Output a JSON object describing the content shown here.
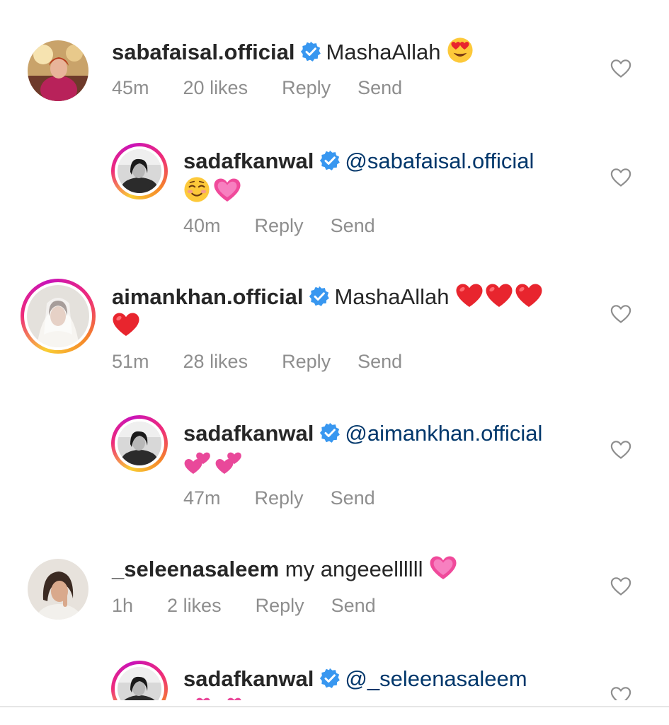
{
  "comments": [
    {
      "username": "sabafaisal.official",
      "verified": true,
      "text": "MashaAllah",
      "emojis": [
        "heart-eyes"
      ],
      "time": "45m",
      "likes": "20 likes",
      "reply": "Reply",
      "send": "Send"
    },
    {
      "username": "sadafkanwal",
      "verified": true,
      "mention": "@sabafaisal.official",
      "emojis": [
        "smiling-blush",
        "pink-heart"
      ],
      "time": "40m",
      "reply": "Reply",
      "send": "Send"
    },
    {
      "username": "aimankhan.official",
      "verified": true,
      "text": "MashaAllah",
      "emojis": [
        "red-heart",
        "red-heart",
        "red-heart",
        "red-heart"
      ],
      "time": "51m",
      "likes": "28 likes",
      "reply": "Reply",
      "send": "Send"
    },
    {
      "username": "sadafkanwal",
      "verified": true,
      "mention": "@aimankhan.official",
      "emojis": [
        "two-hearts",
        "two-hearts"
      ],
      "time": "47m",
      "reply": "Reply",
      "send": "Send"
    },
    {
      "username": "_seleenasaleem",
      "verified": false,
      "text": "my angeeellllll",
      "emojis": [
        "pink-heart"
      ],
      "time": "1h",
      "likes": "2 likes",
      "reply": "Reply",
      "send": "Send"
    },
    {
      "username": "sadafkanwal",
      "verified": true,
      "mention": "@_seleenasaleem",
      "emojis": [
        "two-hearts",
        "two-hearts"
      ]
    }
  ],
  "colors": {
    "verified": "#3897f0",
    "mention": "#00376b",
    "meta": "#8e8e8e",
    "text": "#262626"
  }
}
